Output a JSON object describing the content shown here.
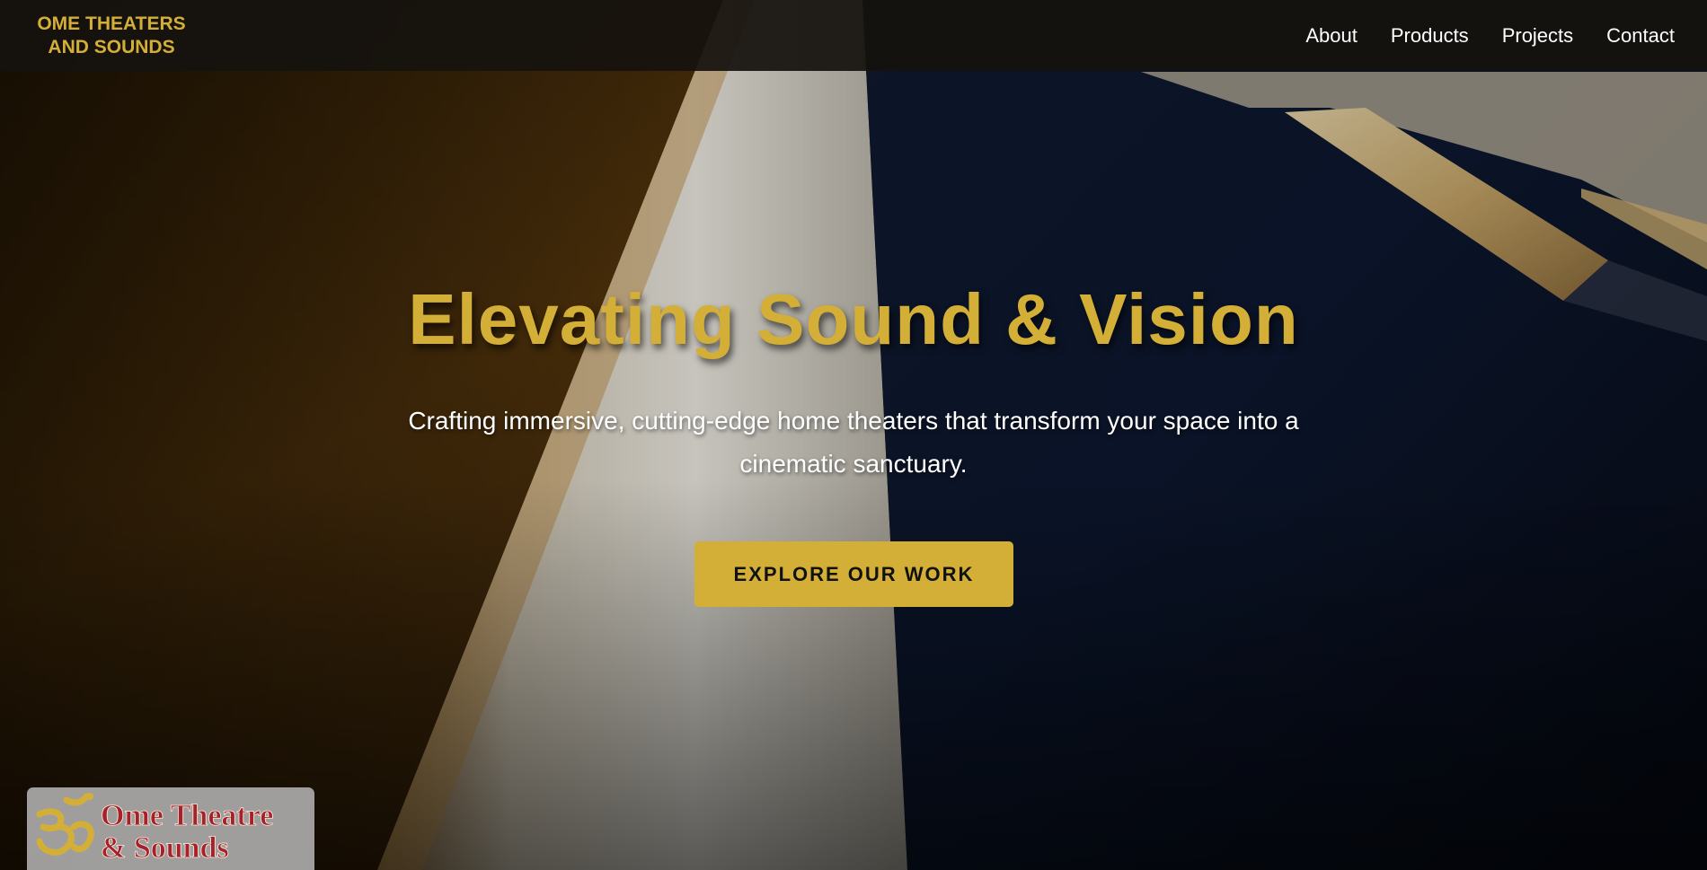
{
  "nav": {
    "brand_line1": "OME THEATERS",
    "brand_line2": "AND SOUNDS",
    "links": [
      "About",
      "Products",
      "Projects",
      "Contact"
    ]
  },
  "hero": {
    "title": "Elevating Sound & Vision",
    "subtitle": "Crafting immersive, cutting-edge home theaters that transform your space into a cinematic sanctuary.",
    "cta_label": "EXPLORE OUR WORK"
  },
  "logo_badge": {
    "line1": "Ome Theatre",
    "line2": "& Sounds",
    "symbol": "om-symbol"
  },
  "colors": {
    "accent_gold": "#d4af37",
    "navbar_bg": "#16120e",
    "logo_red": "#a8202a"
  }
}
